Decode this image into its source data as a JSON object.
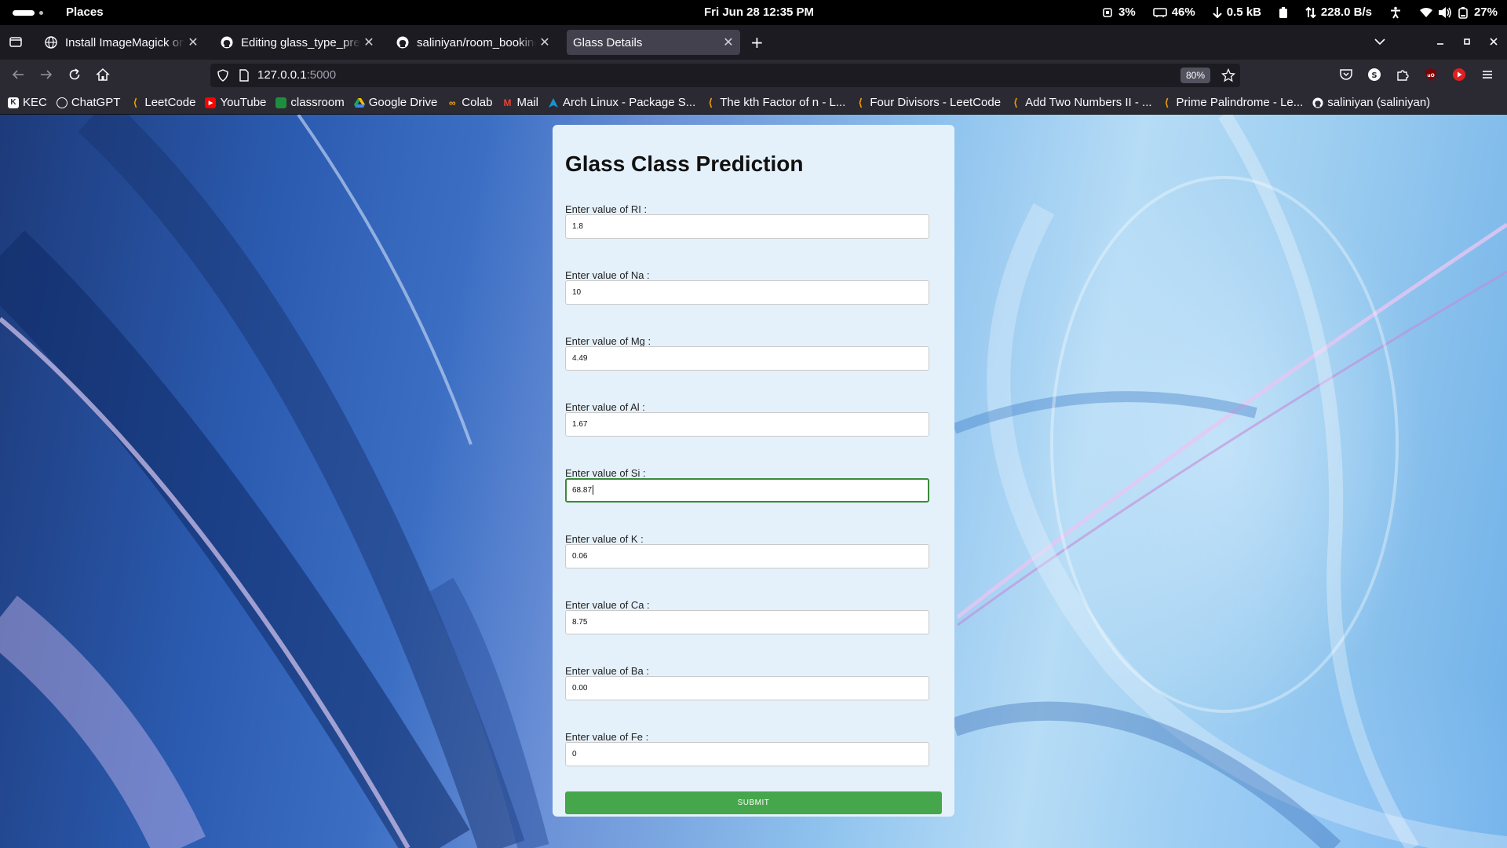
{
  "topbar": {
    "places": "Places",
    "clock": "Fri Jun 28  12:35 PM",
    "cpu": "3%",
    "memory": "46%",
    "download": "0.5 kB",
    "network": "228.0 B/s",
    "battery": "27%"
  },
  "tabs": [
    {
      "title": "Install ImageMagick on Arch Linux",
      "favicon": "globe-icon",
      "active": false
    },
    {
      "title": "Editing glass_type_prediction",
      "favicon": "github-icon",
      "active": false
    },
    {
      "title": "saliniyan/room_booking",
      "favicon": "github-icon",
      "active": false
    },
    {
      "title": "Glass Details",
      "favicon": "",
      "active": true
    }
  ],
  "navbar": {
    "url_host": "127.0.0.1",
    "url_port": ":5000",
    "zoom": "80%"
  },
  "bookmarks": [
    {
      "label": "KEC",
      "icon": "kec-icon"
    },
    {
      "label": "ChatGPT",
      "icon": "chatgpt-icon"
    },
    {
      "label": "LeetCode",
      "icon": "leetcode-icon"
    },
    {
      "label": "YouTube",
      "icon": "youtube-icon"
    },
    {
      "label": "classroom",
      "icon": "classroom-icon"
    },
    {
      "label": "Google Drive",
      "icon": "drive-icon"
    },
    {
      "label": "Colab",
      "icon": "colab-icon"
    },
    {
      "label": "Mail",
      "icon": "mail-icon"
    },
    {
      "label": "Arch Linux - Package S...",
      "icon": "arch-icon"
    },
    {
      "label": "The kth Factor of n - L...",
      "icon": "leetcode-icon"
    },
    {
      "label": "Four Divisors - LeetCode",
      "icon": "leetcode-icon"
    },
    {
      "label": "Add Two Numbers II - ...",
      "icon": "leetcode-icon"
    },
    {
      "label": "Prime Palindrome - Le...",
      "icon": "leetcode-icon"
    },
    {
      "label": "saliniyan (saliniyan)",
      "icon": "github-icon"
    }
  ],
  "form": {
    "title": "Glass Class Prediction",
    "fields": [
      {
        "label": "Enter value of RI :",
        "value": "1.8"
      },
      {
        "label": "Enter value of Na :",
        "value": "10"
      },
      {
        "label": "Enter value of Mg :",
        "value": "4.49"
      },
      {
        "label": "Enter value of Al :",
        "value": "1.67"
      },
      {
        "label": "Enter value of Si :",
        "value": "68.87",
        "focused": true
      },
      {
        "label": "Enter value of K :",
        "value": "0.06"
      },
      {
        "label": "Enter value of Ca :",
        "value": "8.75"
      },
      {
        "label": "Enter value of Ba :",
        "value": "0.00"
      },
      {
        "label": "Enter value of Fe :",
        "value": "0"
      }
    ],
    "submit_label": "SUBMIT"
  },
  "colors": {
    "submit_green": "#46a64b",
    "card_bg": "#e5f1fa",
    "focus_border": "#3a8a3a"
  }
}
